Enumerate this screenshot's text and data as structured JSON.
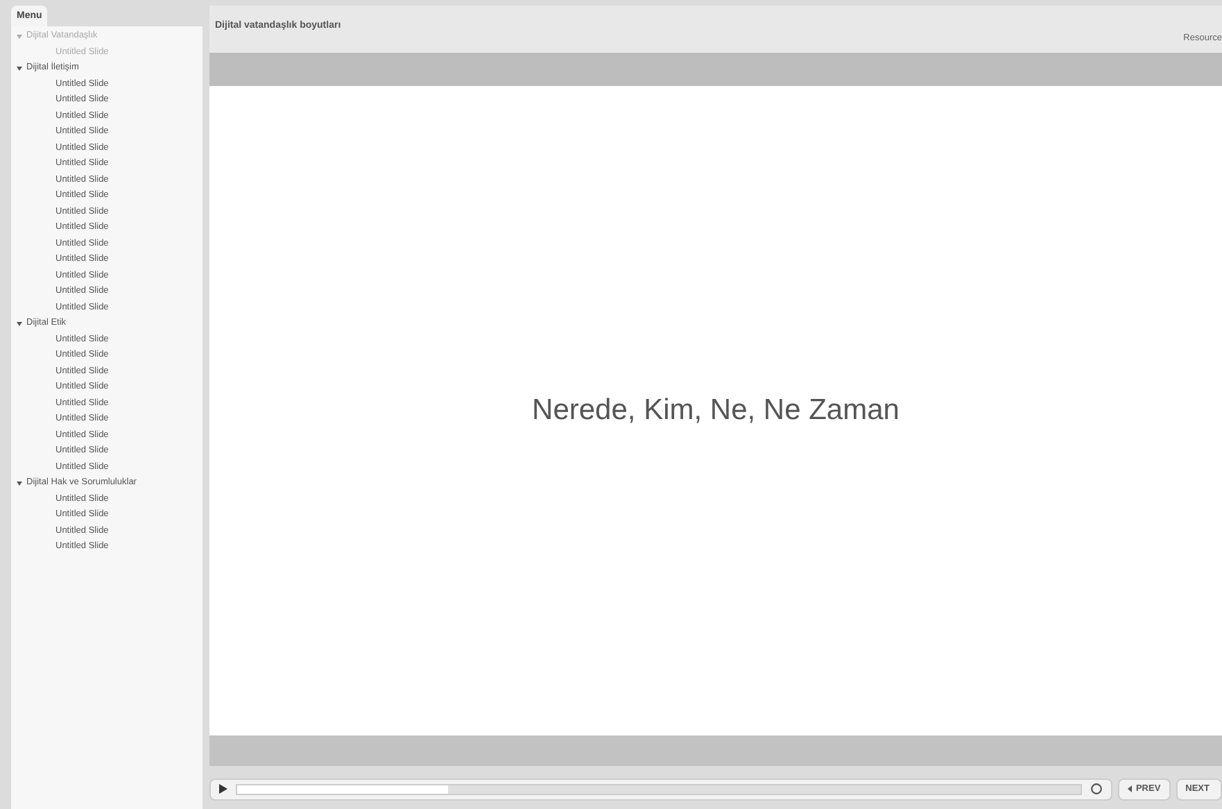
{
  "menu": {
    "title": "Menu",
    "sections": [
      {
        "label": "Dijital Vatandaşlık",
        "expanded": true,
        "visited": true,
        "children": [
          {
            "label": "Untitled Slide",
            "visited": true
          }
        ]
      },
      {
        "label": "Dijital İletişim",
        "expanded": true,
        "visited": false,
        "children": [
          {
            "label": "Untitled Slide",
            "visited": false
          },
          {
            "label": "Untitled Slide",
            "visited": false
          },
          {
            "label": "Untitled Slide",
            "visited": false
          },
          {
            "label": "Untitled Slide",
            "visited": false
          },
          {
            "label": "Untitled Slide",
            "visited": false
          },
          {
            "label": "Untitled Slide",
            "visited": false
          },
          {
            "label": "Untitled Slide",
            "visited": false
          },
          {
            "label": "Untitled Slide",
            "visited": false
          },
          {
            "label": "Untitled Slide",
            "visited": false
          },
          {
            "label": "Untitled Slide",
            "visited": false
          },
          {
            "label": "Untitled Slide",
            "visited": false
          },
          {
            "label": "Untitled Slide",
            "visited": false
          },
          {
            "label": "Untitled Slide",
            "visited": false
          },
          {
            "label": "Untitled Slide",
            "visited": false
          },
          {
            "label": "Untitled Slide",
            "visited": false
          }
        ]
      },
      {
        "label": "Dijital Etik",
        "expanded": true,
        "visited": false,
        "children": [
          {
            "label": "Untitled Slide",
            "visited": false
          },
          {
            "label": "Untitled Slide",
            "visited": false
          },
          {
            "label": "Untitled Slide",
            "visited": false
          },
          {
            "label": "Untitled Slide",
            "visited": false
          },
          {
            "label": "Untitled Slide",
            "visited": false
          },
          {
            "label": "Untitled Slide",
            "visited": false
          },
          {
            "label": "Untitled Slide",
            "visited": false
          },
          {
            "label": "Untitled Slide",
            "visited": false
          },
          {
            "label": "Untitled Slide",
            "visited": false
          }
        ]
      },
      {
        "label": "Dijital Hak ve Sorumluluklar",
        "expanded": true,
        "visited": false,
        "children": [
          {
            "label": "Untitled Slide",
            "visited": false
          },
          {
            "label": "Untitled Slide",
            "visited": false
          },
          {
            "label": "Untitled Slide",
            "visited": false
          },
          {
            "label": "Untitled Slide",
            "visited": false
          }
        ]
      }
    ]
  },
  "header": {
    "title": "Dijital vatandaşlık boyutları",
    "resources": "Resource"
  },
  "slide": {
    "text": "Nerede, Kim, Ne, Ne Zaman"
  },
  "player": {
    "level": 0.25,
    "prev": "PREV",
    "next": "NEXT"
  }
}
